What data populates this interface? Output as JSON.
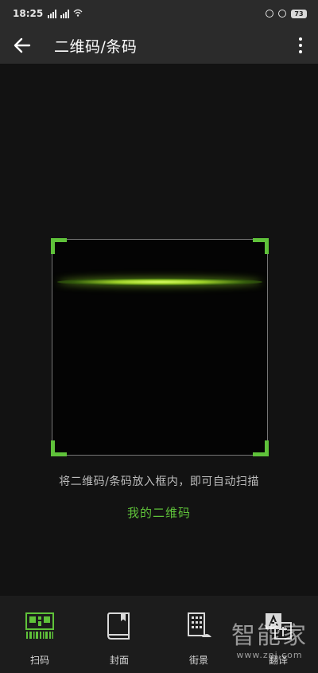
{
  "status_bar": {
    "time": "18:25",
    "battery": "73"
  },
  "toolbar": {
    "title": "二维码/条码"
  },
  "scanner": {
    "hint": "将二维码/条码放入框内，即可自动扫描",
    "my_qr_link": "我的二维码"
  },
  "bottom_tabs": [
    {
      "label": "扫码",
      "icon": "qr-scan-icon",
      "active": true
    },
    {
      "label": "封面",
      "icon": "book-cover-icon",
      "active": false
    },
    {
      "label": "街景",
      "icon": "street-view-icon",
      "active": false
    },
    {
      "label": "翻译",
      "icon": "translate-icon",
      "active": false
    }
  ],
  "watermark": {
    "main": "智能家",
    "sub": "www.znj.com"
  },
  "colors": {
    "accent": "#5fc23a",
    "background": "#121212",
    "bar": "#2b2b2b"
  }
}
